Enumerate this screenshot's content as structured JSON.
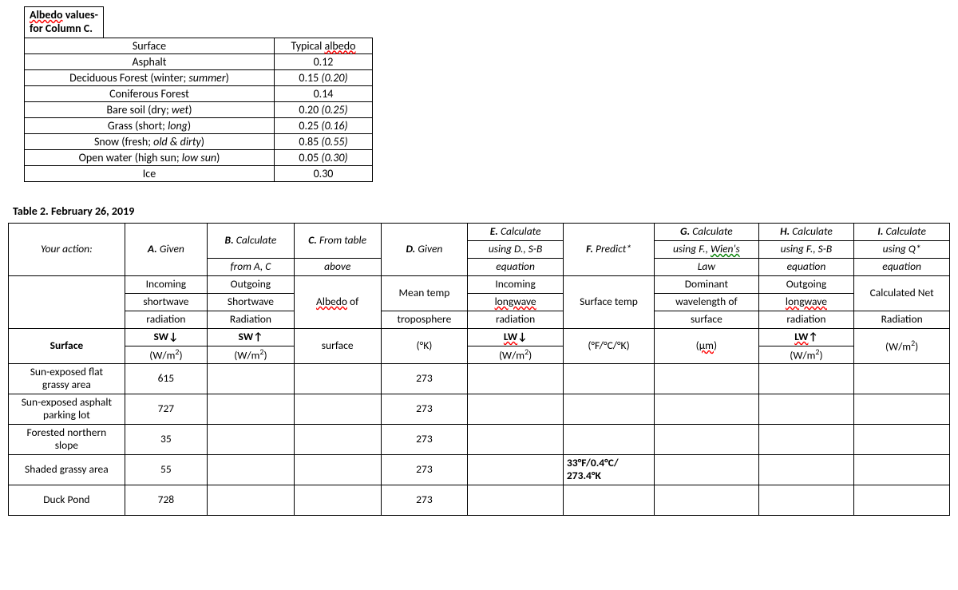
{
  "albedo_block": {
    "title_line1": "Albedo values-",
    "title_line2": "for Column C.",
    "header_surface": "Surface",
    "header_typical": "Typical albedo",
    "rows": [
      {
        "surface": "Asphalt",
        "value": "0.12"
      },
      {
        "surface": "Deciduous Forest (winter; summer)",
        "surface_italic_part": "summer",
        "value": "0.15 (0.20)",
        "value_italic_part": "(0.20)"
      },
      {
        "surface": "Coniferous Forest",
        "value": "0.14"
      },
      {
        "surface": "Bare soil (dry; wet)",
        "surface_italic_part": "wet",
        "value": "0.20 (0.25)",
        "value_italic_part": "(0.25)"
      },
      {
        "surface": "Grass (short; long)",
        "surface_italic_part": "long",
        "value": "0.25 (0.16)",
        "value_italic_part": "(0.16)"
      },
      {
        "surface": "Snow (fresh; old & dirty)",
        "surface_italic_part": "old & dirty",
        "value": "0.85 (0.55)",
        "value_italic_part": "(0.55)"
      },
      {
        "surface": "Open water (high sun; low sun)",
        "surface_italic_part": "low sun",
        "value": "0.05 (0.30)",
        "value_italic_part": "(0.30)"
      },
      {
        "surface": "Ice",
        "value": "0.30"
      }
    ]
  },
  "table2": {
    "title": "Table 2. February 26, 2019",
    "actions_label": "Your action:",
    "colA": {
      "top": "A. Given",
      "mid1": "Incoming",
      "mid2": "shortwave",
      "mid3": "radiation",
      "unit_sym": "SW↓",
      "unit_wm2": "(W/m²)"
    },
    "colB": {
      "top1": "B. Calculate",
      "top2": "from A, C",
      "mid1": "Outgoing",
      "mid2": "Shortwave",
      "mid3": "Radiation",
      "unit_sym": "SW↑",
      "unit_wm2": "(W/m²)"
    },
    "colC": {
      "top1": "C. From table",
      "top2": "above",
      "mid1": "Albedo of",
      "unit": "surface"
    },
    "colD": {
      "top": "D. Given",
      "mid1": "Mean temp",
      "mid2": "troposphere",
      "unit": "(°K)"
    },
    "colE": {
      "top1": "E. Calculate",
      "top2": "using D., S-B",
      "top3": "equation",
      "mid1": "Incoming",
      "mid2": "longwave",
      "mid3": "radiation",
      "unit_sym": "LW↓",
      "unit_wm2": "(W/m²)"
    },
    "colF": {
      "top": "F. Predict*",
      "mid1": "Surface temp",
      "unit": "(°F/°C/°K)"
    },
    "colG": {
      "top1": "G. Calculate",
      "top2": "using F., Wien's",
      "top3": "Law",
      "mid1": "Dominant",
      "mid2": "wavelength of",
      "mid3": "surface",
      "unit": "(µm)"
    },
    "colH": {
      "top1": "H. Calculate",
      "top2": "using F., S-B",
      "top3": "equation",
      "mid1": "Outgoing",
      "mid2": "longwave",
      "mid3": "radiation",
      "unit_sym": "LW↑",
      "unit_wm2": "(W/m²)"
    },
    "colI": {
      "top1": "I. Calculate",
      "top2": "using Q*",
      "top3": "equation",
      "mid1": "Calculated Net",
      "mid2": "Radiation",
      "unit": "(W/m²)"
    },
    "surface_header": "Surface",
    "rows": [
      {
        "name_l1": "Sun-exposed flat",
        "name_l2": "grassy area",
        "A": "615",
        "D": "273"
      },
      {
        "name_l1": "Sun-exposed asphalt",
        "name_l2": "parking lot",
        "A": "727",
        "D": "273"
      },
      {
        "name_l1": "Forested northern",
        "name_l2": "slope",
        "A": "35",
        "D": "273"
      },
      {
        "name_l1": "Shaded grassy area",
        "A": "55",
        "D": "273",
        "F": "33°F/0.4°C/ 273.4°K"
      },
      {
        "name_l1": "Duck Pond",
        "A": "728",
        "D": "273"
      }
    ]
  }
}
